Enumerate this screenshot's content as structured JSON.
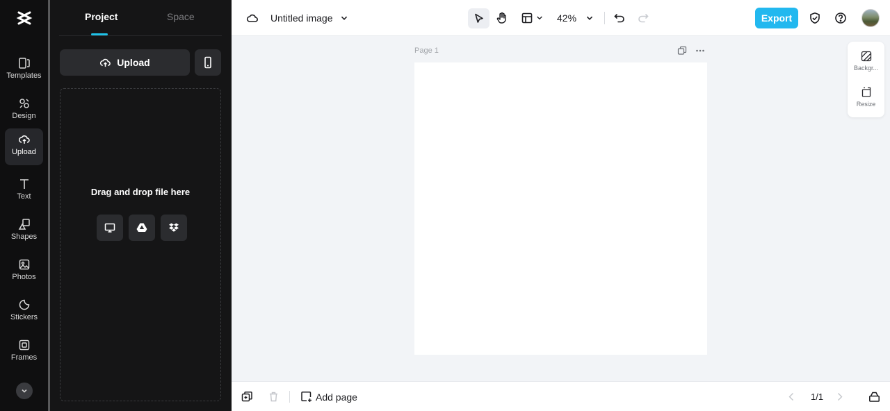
{
  "rail": {
    "items": [
      {
        "label": "Templates",
        "icon": "templates-icon"
      },
      {
        "label": "Design",
        "icon": "design-icon"
      },
      {
        "label": "Upload",
        "icon": "upload-cloud-icon",
        "active": true
      },
      {
        "label": "Text",
        "icon": "text-icon"
      },
      {
        "label": "Shapes",
        "icon": "shapes-icon"
      },
      {
        "label": "Photos",
        "icon": "photos-icon"
      },
      {
        "label": "Stickers",
        "icon": "stickers-icon"
      },
      {
        "label": "Frames",
        "icon": "frames-icon"
      }
    ]
  },
  "panel": {
    "tabs": [
      {
        "label": "Project",
        "active": true
      },
      {
        "label": "Space",
        "active": false
      }
    ],
    "upload_label": "Upload",
    "dropzone_text": "Drag and drop file here",
    "sources": [
      "computer-icon",
      "google-drive-icon",
      "dropbox-icon"
    ]
  },
  "topbar": {
    "title": "Untitled image",
    "zoom": "42%",
    "export_label": "Export"
  },
  "canvas": {
    "page_label": "Page 1",
    "right_tools": [
      {
        "label": "Backgr...",
        "icon": "background-icon"
      },
      {
        "label": "Resize",
        "icon": "resize-icon"
      }
    ]
  },
  "bottombar": {
    "add_page_label": "Add page",
    "page_indicator": "1/1"
  },
  "colors": {
    "accent": "#22b8ef",
    "tab_underline": "#1fc2e8",
    "rail_bg": "#0f0f10",
    "panel_bg": "#151516",
    "canvas_bg": "#f2f4f7"
  }
}
